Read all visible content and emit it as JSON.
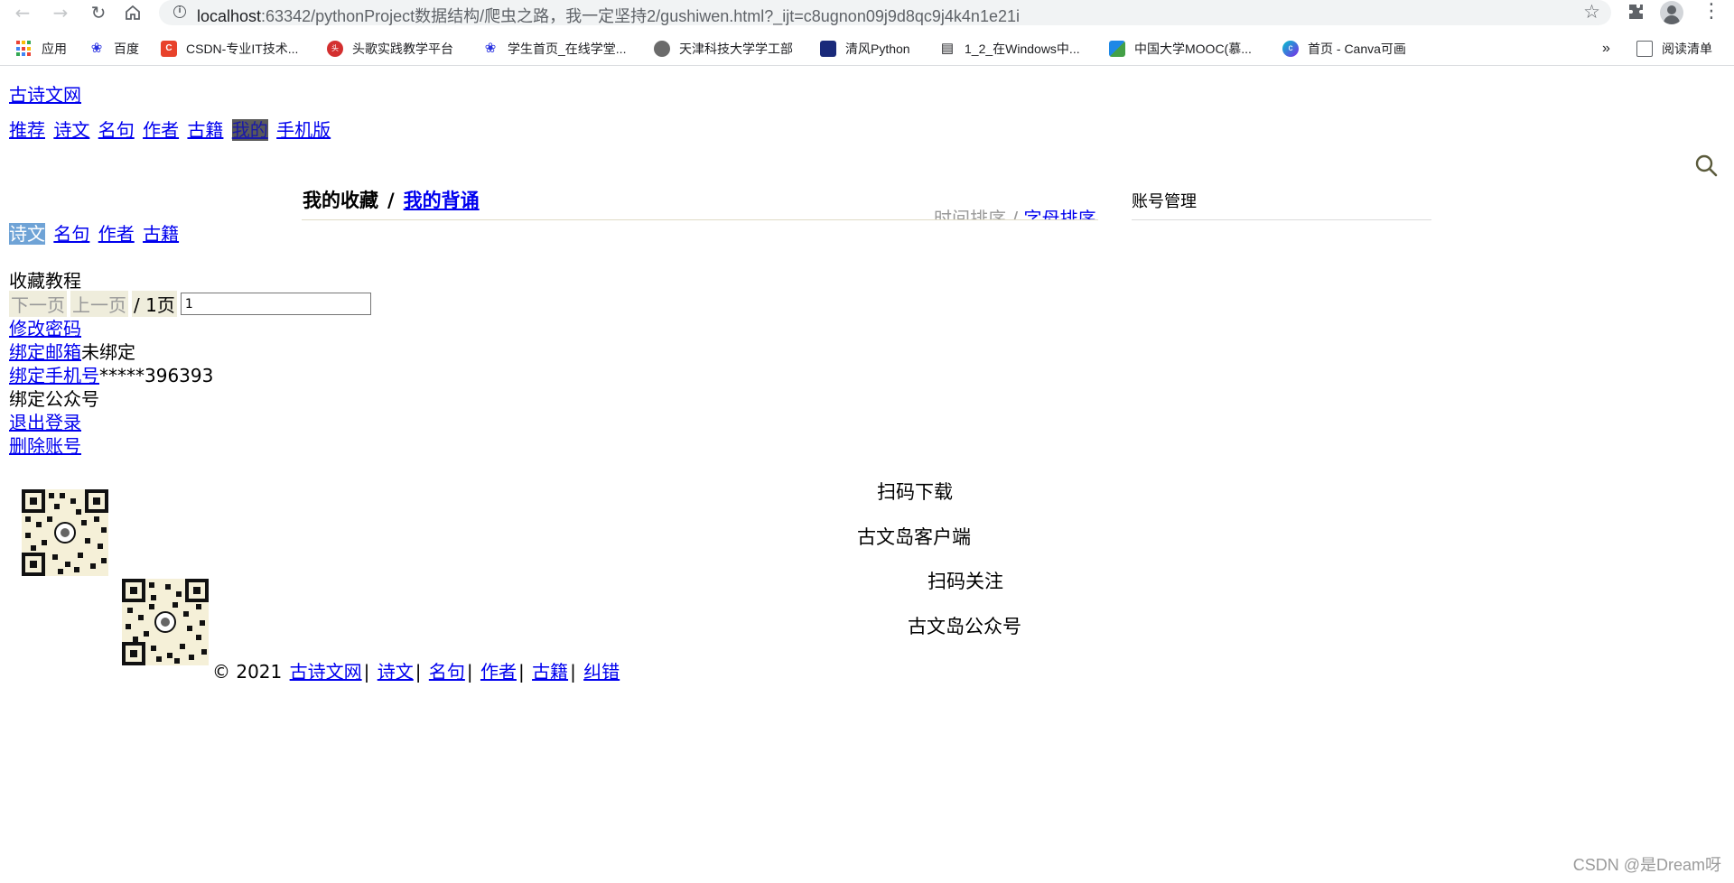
{
  "browser": {
    "url_host": "localhost",
    "url_rest": ":63342/pythonProject数据结构/爬虫之路，我一定坚持2/gushiwen.html?_ijt=c8ugnon09j9d8qc9j4k4n1e21i",
    "bookmarks": [
      {
        "label": "应用",
        "icon": "apps-icon"
      },
      {
        "label": "百度",
        "icon": "baidu-icon"
      },
      {
        "label": "CSDN-专业IT技术...",
        "icon": "csdn-icon"
      },
      {
        "label": "头歌实践教学平台",
        "icon": "touge-icon"
      },
      {
        "label": "学生首页_在线学堂...",
        "icon": "paw-icon"
      },
      {
        "label": "天津科技大学学工部",
        "icon": "globe-icon"
      },
      {
        "label": "清风Python",
        "icon": "qingfeng-icon"
      },
      {
        "label": "1_2_在Windows中...",
        "icon": "book-icon"
      },
      {
        "label": "中国大学MOOC(慕...",
        "icon": "mooc-icon"
      },
      {
        "label": "首页 - Canva可画",
        "icon": "canva-icon"
      }
    ],
    "more_bookmarks": "»",
    "reading_list": "阅读清单"
  },
  "site": {
    "title": "古诗文网",
    "nav": [
      "推荐",
      "诗文",
      "名句",
      "作者",
      "古籍",
      "我的",
      "手机版"
    ],
    "nav_current": "我的"
  },
  "main": {
    "favorites_label": "我的收藏",
    "separator": "/",
    "recite_label": "我的背诵",
    "sort_text": "时间排序 / ",
    "sort_link": "字母排序",
    "account_title": "账号管理",
    "subtabs": [
      "诗文",
      "名句",
      "作者",
      "古籍"
    ],
    "subtab_current": "诗文",
    "tutorial_img_alt": "收藏教程",
    "pager": {
      "next": "下一页",
      "prev": "上一页",
      "total": "/ 1页",
      "input_value": "1"
    }
  },
  "account": {
    "change_password": "修改密码",
    "bind_email": "绑定邮箱",
    "email_status": "未绑定",
    "bind_phone": "绑定手机号",
    "phone_value": "*****396393",
    "bind_wechat": "绑定公众号",
    "logout": "退出登录",
    "delete_account": "删除账号"
  },
  "footer": {
    "scan_download": "扫码下载",
    "client_name": "古文岛客户端",
    "scan_follow": "扫码关注",
    "official_account": "古文岛公众号",
    "copyright_prefix": "© 2021",
    "links": [
      "古诗文网",
      "诗文",
      "名句",
      "作者",
      "古籍",
      "纠错"
    ],
    "divider": "|"
  },
  "watermark": "CSDN @是Dream呀",
  "colors": {
    "link": "#0000ee",
    "current_tab": "#6fa3d6",
    "current_nav": "#5a5a5a",
    "pager_bg": "#efeddc"
  }
}
